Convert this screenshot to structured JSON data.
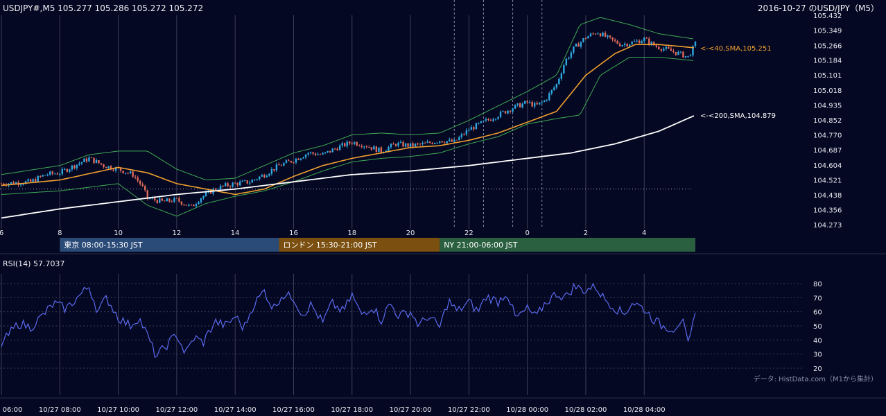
{
  "header": {
    "quote_line": "USDJPY#,M5 105.277 105.286 105.272 105.272",
    "title_right": "2016-10-27 のUSD/JPY（M5）"
  },
  "colors": {
    "background": "#050822",
    "grid": "#3a3e55",
    "candle_up": "#2fa8e0",
    "candle_down": "#e06a5a",
    "sma40": "#f0a030",
    "sma200": "#ffffff",
    "bollinger": "#3faa55",
    "rsi": "#5a6af0",
    "session_tokyo": "#2a4a78",
    "session_london": "#7a4f10",
    "session_ny": "#2a6040"
  },
  "sessions": [
    {
      "label": "東京 08:00-15:30 JST",
      "start": 8.0,
      "end": 15.5
    },
    {
      "label": "ロンドン 15:30-21:00 JST",
      "start": 15.5,
      "end": 21.0
    },
    {
      "label": "NY 21:00-06:00 JST",
      "start": 21.0,
      "end": 30.0
    }
  ],
  "rsi_label": "RSI(14) 57.7037",
  "source_note": "データ: HistData.com（M1から集計）",
  "chart_data": [
    {
      "type": "candlestick",
      "timeframe": "M5",
      "x_range_hours": [
        6,
        29.75
      ],
      "ylim": [
        104.273,
        105.432
      ],
      "y_ticks": [
        "105.432",
        "105.349",
        "105.266",
        "105.184",
        "105.101",
        "105.018",
        "104.935",
        "104.852",
        "104.770",
        "104.687",
        "104.604",
        "104.521",
        "104.438",
        "104.356",
        "104.273"
      ],
      "x_ticks": [
        {
          "label": "6",
          "h": 6
        },
        {
          "label": "8",
          "h": 8
        },
        {
          "label": "10",
          "h": 10
        },
        {
          "label": "12",
          "h": 12
        },
        {
          "label": "14",
          "h": 14
        },
        {
          "label": "16",
          "h": 16
        },
        {
          "label": "18",
          "h": 18
        },
        {
          "label": "20",
          "h": 20
        },
        {
          "label": "22",
          "h": 22
        },
        {
          "label": "0",
          "h": 24
        },
        {
          "label": "2",
          "h": 26
        },
        {
          "label": "4",
          "h": 28
        }
      ],
      "close_path": [
        [
          6.0,
          104.5
        ],
        [
          7.0,
          104.51
        ],
        [
          7.5,
          104.55
        ],
        [
          8.0,
          104.56
        ],
        [
          8.5,
          104.6
        ],
        [
          9.0,
          104.64
        ],
        [
          9.5,
          104.6
        ],
        [
          10.0,
          104.58
        ],
        [
          10.5,
          104.55
        ],
        [
          10.8,
          104.49
        ],
        [
          11.0,
          104.42
        ],
        [
          11.5,
          104.4
        ],
        [
          12.0,
          104.41
        ],
        [
          12.5,
          104.37
        ],
        [
          12.8,
          104.42
        ],
        [
          13.3,
          104.47
        ],
        [
          13.7,
          104.49
        ],
        [
          14.0,
          104.5
        ],
        [
          14.5,
          104.51
        ],
        [
          15.0,
          104.55
        ],
        [
          15.5,
          104.6
        ],
        [
          16.0,
          104.63
        ],
        [
          16.5,
          104.67
        ],
        [
          17.0,
          104.66
        ],
        [
          17.5,
          104.7
        ],
        [
          18.0,
          104.73
        ],
        [
          18.5,
          104.71
        ],
        [
          19.0,
          104.68
        ],
        [
          19.5,
          104.72
        ],
        [
          20.0,
          104.71
        ],
        [
          20.5,
          104.72
        ],
        [
          21.0,
          104.74
        ],
        [
          21.5,
          104.73
        ],
        [
          22.0,
          104.8
        ],
        [
          22.5,
          104.84
        ],
        [
          23.0,
          104.88
        ],
        [
          23.5,
          104.92
        ],
        [
          24.0,
          104.95
        ],
        [
          24.3,
          104.93
        ],
        [
          24.6,
          104.96
        ],
        [
          25.0,
          105.05
        ],
        [
          25.3,
          105.18
        ],
        [
          25.6,
          105.25
        ],
        [
          26.0,
          105.31
        ],
        [
          26.4,
          105.34
        ],
        [
          26.8,
          105.3
        ],
        [
          27.2,
          105.27
        ],
        [
          27.6,
          105.28
        ],
        [
          28.0,
          105.3
        ],
        [
          28.4,
          105.26
        ],
        [
          28.8,
          105.24
        ],
        [
          29.2,
          105.22
        ],
        [
          29.5,
          105.2
        ],
        [
          29.75,
          105.272
        ]
      ],
      "sma_labels": [
        {
          "text": "<-<40,SMA,105.251",
          "value": 105.251,
          "color": "#f0a030"
        },
        {
          "text": "<-<200,SMA,104.879",
          "value": 104.879,
          "color": "#ffffff"
        }
      ],
      "sma40": [
        [
          6.0,
          104.49
        ],
        [
          8.0,
          104.52
        ],
        [
          10.0,
          104.59
        ],
        [
          11.0,
          104.56
        ],
        [
          12.0,
          104.5
        ],
        [
          13.0,
          104.47
        ],
        [
          14.0,
          104.44
        ],
        [
          15.0,
          104.47
        ],
        [
          16.0,
          104.54
        ],
        [
          17.0,
          104.6
        ],
        [
          18.0,
          104.64
        ],
        [
          19.0,
          104.67
        ],
        [
          20.0,
          104.7
        ],
        [
          21.0,
          104.71
        ],
        [
          22.0,
          104.74
        ],
        [
          23.0,
          104.78
        ],
        [
          24.0,
          104.84
        ],
        [
          25.0,
          104.9
        ],
        [
          26.0,
          105.1
        ],
        [
          27.0,
          105.22
        ],
        [
          27.7,
          105.27
        ],
        [
          28.5,
          105.27
        ],
        [
          29.2,
          105.26
        ],
        [
          29.75,
          105.251
        ]
      ],
      "sma200": [
        [
          6.0,
          104.31
        ],
        [
          8.0,
          104.36
        ],
        [
          10.0,
          104.4
        ],
        [
          12.0,
          104.44
        ],
        [
          14.0,
          104.47
        ],
        [
          16.0,
          104.51
        ],
        [
          18.0,
          104.55
        ],
        [
          20.0,
          104.57
        ],
        [
          22.0,
          104.6
        ],
        [
          24.0,
          104.64
        ],
        [
          25.5,
          104.67
        ],
        [
          27.0,
          104.72
        ],
        [
          28.5,
          104.79
        ],
        [
          29.75,
          104.879
        ]
      ],
      "bollinger_upper": [
        [
          6.0,
          104.55
        ],
        [
          8.0,
          104.6
        ],
        [
          9.0,
          104.66
        ],
        [
          10.0,
          104.68
        ],
        [
          11.0,
          104.68
        ],
        [
          12.0,
          104.58
        ],
        [
          13.0,
          104.52
        ],
        [
          14.0,
          104.53
        ],
        [
          15.0,
          104.6
        ],
        [
          16.0,
          104.67
        ],
        [
          17.0,
          104.71
        ],
        [
          18.0,
          104.77
        ],
        [
          19.0,
          104.78
        ],
        [
          20.0,
          104.77
        ],
        [
          21.0,
          104.78
        ],
        [
          22.0,
          104.85
        ],
        [
          23.0,
          104.93
        ],
        [
          24.0,
          105.01
        ],
        [
          25.0,
          105.1
        ],
        [
          25.8,
          105.38
        ],
        [
          26.5,
          105.42
        ],
        [
          27.5,
          105.38
        ],
        [
          28.5,
          105.33
        ],
        [
          29.75,
          105.3
        ]
      ],
      "bollinger_lower": [
        [
          6.0,
          104.44
        ],
        [
          8.0,
          104.46
        ],
        [
          9.0,
          104.48
        ],
        [
          10.0,
          104.5
        ],
        [
          11.0,
          104.38
        ],
        [
          12.0,
          104.32
        ],
        [
          13.0,
          104.39
        ],
        [
          14.0,
          104.43
        ],
        [
          15.0,
          104.46
        ],
        [
          16.0,
          104.51
        ],
        [
          17.0,
          104.57
        ],
        [
          18.0,
          104.62
        ],
        [
          19.0,
          104.64
        ],
        [
          20.0,
          104.65
        ],
        [
          21.0,
          104.67
        ],
        [
          22.0,
          104.72
        ],
        [
          23.0,
          104.76
        ],
        [
          24.0,
          104.83
        ],
        [
          25.0,
          104.86
        ],
        [
          25.8,
          104.88
        ],
        [
          26.5,
          105.1
        ],
        [
          27.5,
          105.2
        ],
        [
          28.5,
          105.2
        ],
        [
          29.75,
          105.18
        ]
      ],
      "vertical_markers_hours": [
        21.5,
        22.5,
        23.5,
        24.5
      ],
      "dotted_level": 104.47
    },
    {
      "type": "line",
      "title": "RSI(14) 57.7037",
      "ylim": [
        20,
        80
      ],
      "y_ticks": [
        80,
        70,
        60,
        50,
        40,
        30,
        20
      ],
      "x_ticks": [
        {
          "label": "10/27 06:00",
          "h": 6
        },
        {
          "label": "10/27 08:00",
          "h": 8
        },
        {
          "label": "10/27 10:00",
          "h": 10
        },
        {
          "label": "10/27 12:00",
          "h": 12
        },
        {
          "label": "10/27 14:00",
          "h": 14
        },
        {
          "label": "10/27 16:00",
          "h": 16
        },
        {
          "label": "10/27 18:00",
          "h": 18
        },
        {
          "label": "10/27 20:00",
          "h": 20
        },
        {
          "label": "10/27 22:00",
          "h": 22
        },
        {
          "label": "10/28 00:00",
          "h": 24
        },
        {
          "label": "10/28 02:00",
          "h": 26
        },
        {
          "label": "10/28 04:00",
          "h": 28
        }
      ],
      "series": [
        {
          "values_path": [
            [
              6.0,
              37
            ],
            [
              6.3,
              45
            ],
            [
              6.6,
              52
            ],
            [
              7.0,
              49
            ],
            [
              7.4,
              57
            ],
            [
              7.8,
              66
            ],
            [
              8.2,
              62
            ],
            [
              8.6,
              70
            ],
            [
              9.0,
              78
            ],
            [
              9.3,
              60
            ],
            [
              9.6,
              70
            ],
            [
              10.0,
              56
            ],
            [
              10.4,
              50
            ],
            [
              10.7,
              56
            ],
            [
              11.0,
              43
            ],
            [
              11.3,
              28
            ],
            [
              11.6,
              35
            ],
            [
              12.0,
              44
            ],
            [
              12.3,
              30
            ],
            [
              12.6,
              42
            ],
            [
              12.9,
              38
            ],
            [
              13.3,
              53
            ],
            [
              13.7,
              50
            ],
            [
              14.0,
              57
            ],
            [
              14.3,
              48
            ],
            [
              14.6,
              64
            ],
            [
              15.0,
              75
            ],
            [
              15.3,
              62
            ],
            [
              15.6,
              72
            ],
            [
              16.0,
              70
            ],
            [
              16.3,
              58
            ],
            [
              16.6,
              65
            ],
            [
              17.0,
              52
            ],
            [
              17.3,
              66
            ],
            [
              17.7,
              60
            ],
            [
              18.0,
              72
            ],
            [
              18.3,
              58
            ],
            [
              18.7,
              64
            ],
            [
              19.0,
              54
            ],
            [
              19.3,
              66
            ],
            [
              19.6,
              57
            ],
            [
              20.0,
              60
            ],
            [
              20.3,
              50
            ],
            [
              20.6,
              57
            ],
            [
              21.0,
              49
            ],
            [
              21.3,
              68
            ],
            [
              21.6,
              60
            ],
            [
              22.0,
              67
            ],
            [
              22.3,
              60
            ],
            [
              22.6,
              71
            ],
            [
              23.0,
              67
            ],
            [
              23.3,
              74
            ],
            [
              23.6,
              55
            ],
            [
              24.0,
              62
            ],
            [
              24.3,
              56
            ],
            [
              24.6,
              66
            ],
            [
              25.0,
              73
            ],
            [
              25.3,
              70
            ],
            [
              25.6,
              78
            ],
            [
              26.0,
              75
            ],
            [
              26.3,
              79
            ],
            [
              26.6,
              70
            ],
            [
              27.0,
              63
            ],
            [
              27.3,
              58
            ],
            [
              27.6,
              67
            ],
            [
              28.0,
              62
            ],
            [
              28.3,
              55
            ],
            [
              28.6,
              50
            ],
            [
              29.0,
              48
            ],
            [
              29.3,
              55
            ],
            [
              29.5,
              36
            ],
            [
              29.6,
              44
            ],
            [
              29.75,
              58
            ]
          ]
        }
      ]
    }
  ]
}
